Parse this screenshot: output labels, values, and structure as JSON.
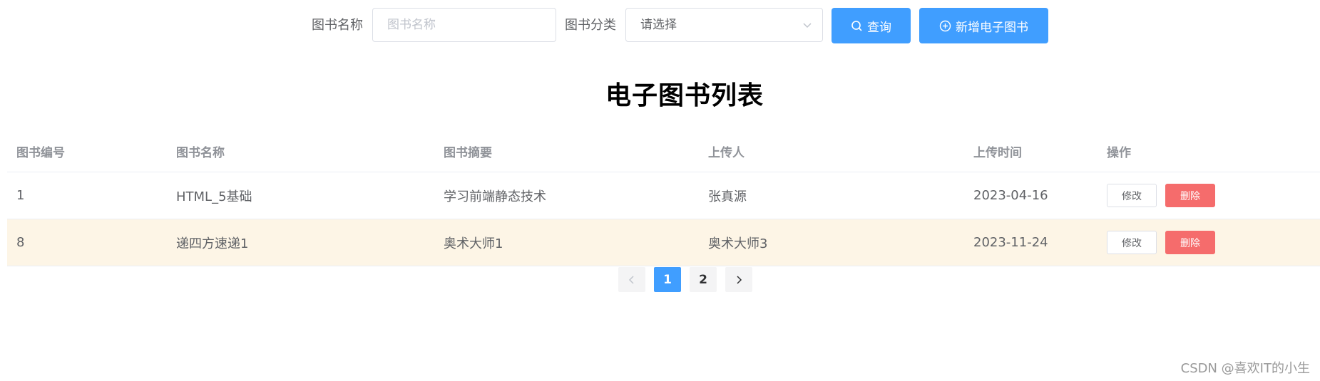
{
  "search": {
    "name_label": "图书名称",
    "name_placeholder": "图书名称",
    "category_label": "图书分类",
    "category_placeholder": "请选择",
    "query_label": "查询",
    "add_label": "新增电子图书"
  },
  "page_title": "电子图书列表",
  "table": {
    "columns": [
      "图书编号",
      "图书名称",
      "图书摘要",
      "上传人",
      "上传时间",
      "操作"
    ],
    "rows": [
      {
        "id": "1",
        "name": "HTML_5基础",
        "summary": "学习前端静态技术",
        "uploader": "张真源",
        "date": "2023-04-16"
      },
      {
        "id": "8",
        "name": "递四方速递1",
        "summary": "奥术大师1",
        "uploader": "奥术大师3",
        "date": "2023-11-24"
      }
    ],
    "edit_label": "修改",
    "delete_label": "删除"
  },
  "pagination": {
    "pages": [
      "1",
      "2"
    ],
    "current": "1"
  },
  "watermark": "CSDN @喜欢IT的小生",
  "colors": {
    "primary": "#409eff",
    "danger": "#f56c6c",
    "row_highlight": "#fdf5e6"
  }
}
